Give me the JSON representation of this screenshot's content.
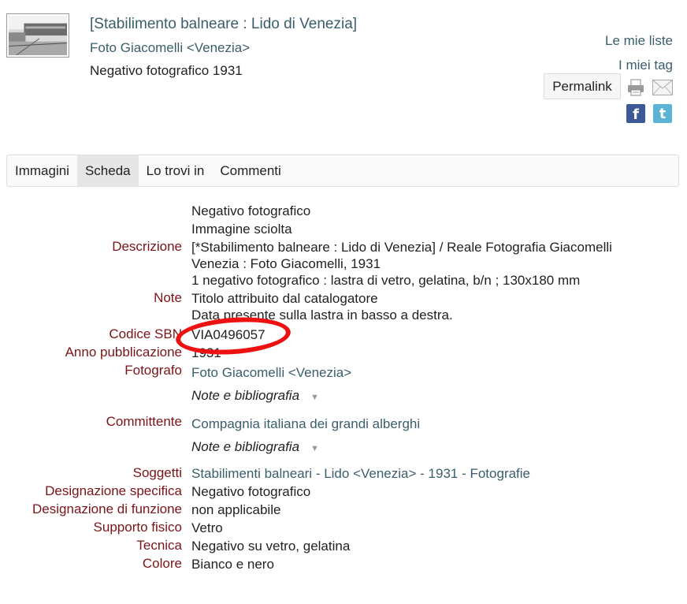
{
  "header": {
    "title": "[Stabilimento balneare : Lido di Venezia]",
    "author": "Foto Giacomelli <Venezia>",
    "type_year": "Negativo fotografico 1931"
  },
  "actions": {
    "my_lists": "Le mie liste",
    "my_tags": "I miei tag",
    "permalink": "Permalink",
    "print_icon": "print-icon",
    "mail_icon": "mail-icon",
    "facebook_icon": "f",
    "twitter_icon": "t"
  },
  "tabs": [
    "Immagini",
    "Scheda",
    "Lo trovi in",
    "Commenti"
  ],
  "active_tab": "Scheda",
  "record": {
    "pre_lines": [
      "Negativo fotografico",
      "Immagine sciolta"
    ],
    "descrizione_label": "Descrizione",
    "descrizione_lines": [
      "[*Stabilimento balneare : Lido di Venezia] / Reale Fotografia Giacomelli",
      "Venezia : Foto Giacomelli, 1931",
      "1 negativo fotografico : lastra di vetro, gelatina, b/n ; 130x180 mm"
    ],
    "note_label": "Note",
    "note_lines": [
      "Titolo attribuito dal catalogatore",
      "Data presente sulla lastra in basso a destra."
    ],
    "codice_label": "Codice SBN",
    "codice_value": "VIA0496057",
    "anno_label": "Anno pubblicazione",
    "anno_value": "1931",
    "fotografo_label": "Fotografo",
    "fotografo_value": "Foto Giacomelli <Venezia>",
    "note_bibliografia": "Note e bibliografia",
    "committente_label": "Committente",
    "committente_value": "Compagnia italiana dei grandi alberghi",
    "soggetti_label": "Soggetti",
    "soggetti": [
      "Stabilimenti balneari",
      "Lido <Venezia>",
      "1931",
      "Fotografie"
    ],
    "soggetti_sep": " - ",
    "designazione_specifica_label": "Designazione specifica",
    "designazione_specifica_value": "Negativo fotografico",
    "designazione_funzione_label": "Designazione di funzione",
    "designazione_funzione_value": "non applicabile",
    "supporto_label": "Supporto fisico",
    "supporto_value": "Vetro",
    "tecnica_label": "Tecnica",
    "tecnica_value": "Negativo su vetro, gelatina",
    "colore_label": "Colore",
    "colore_value": "Bianco e nero"
  },
  "colors": {
    "label": "#7a1418",
    "link": "#3a5e6b",
    "highlight": "#ee1111"
  }
}
